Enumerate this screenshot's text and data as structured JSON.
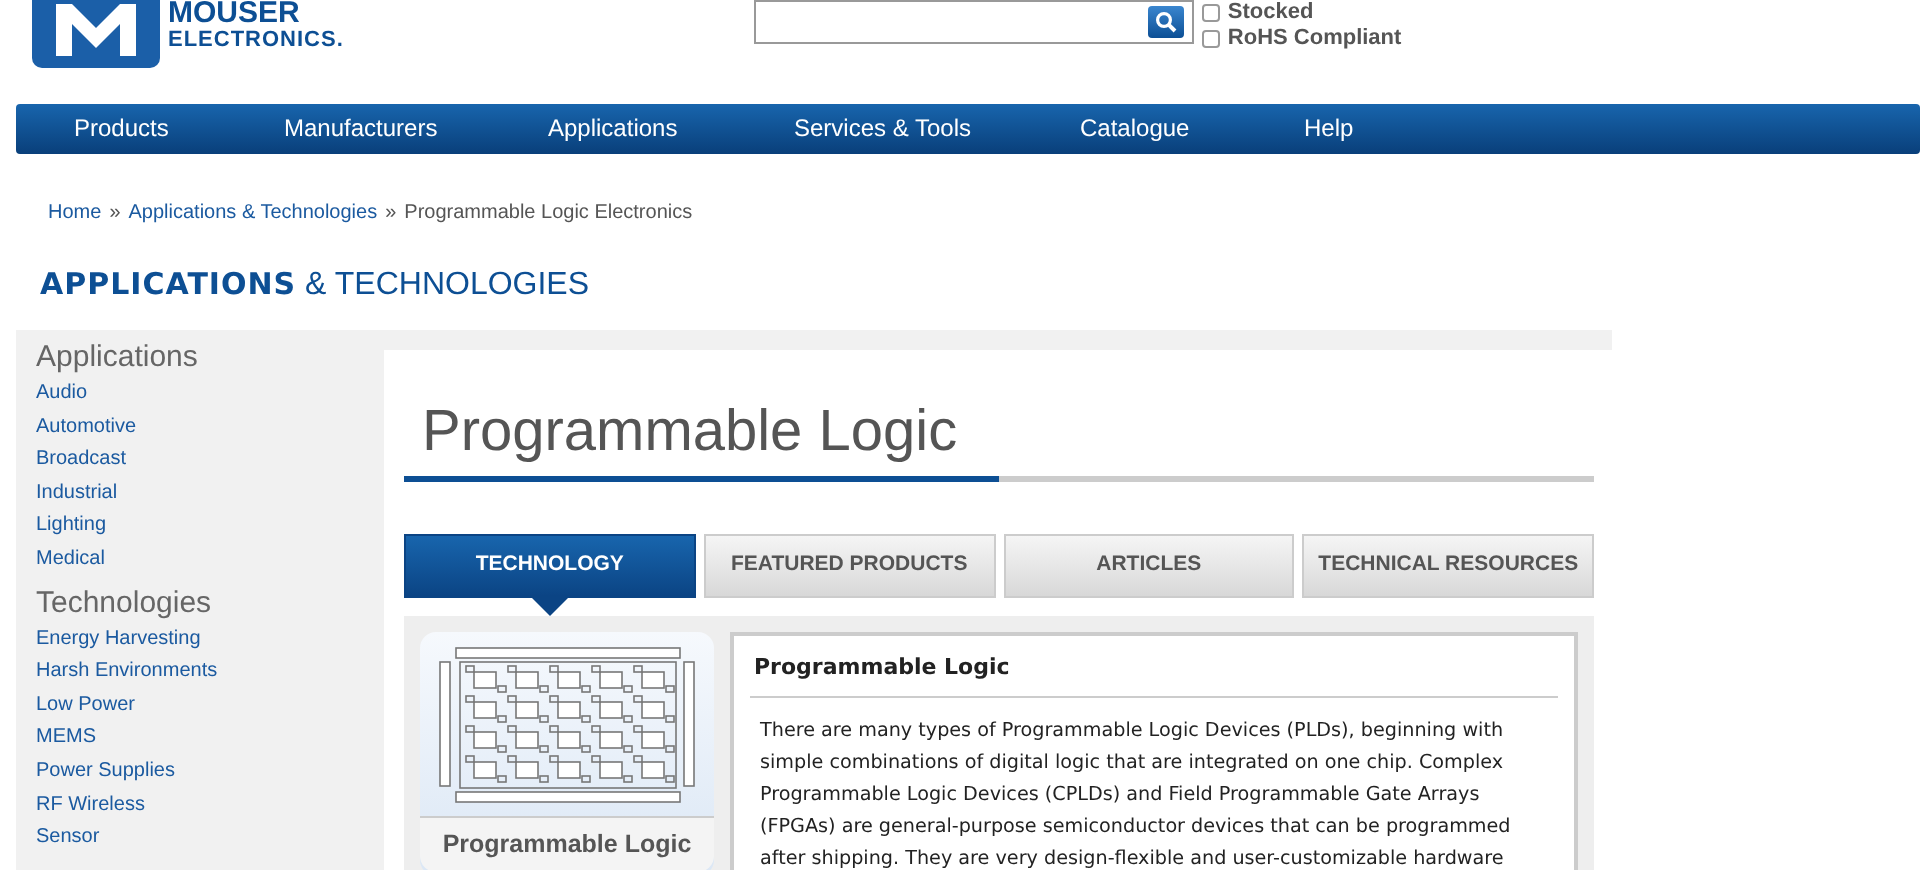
{
  "logo": {
    "name": "MOUSER",
    "subtitle": "ELECTRONICS."
  },
  "filters": [
    {
      "label": "Stocked",
      "checked": false
    },
    {
      "label": "RoHS Compliant",
      "checked": false
    }
  ],
  "nav": [
    "Products",
    "Manufacturers",
    "Applications",
    "Services & Tools",
    "Catalogue",
    "Help"
  ],
  "breadcrumb": [
    {
      "label": "Home",
      "link": true
    },
    {
      "label": "Applications & Technologies",
      "link": true
    },
    {
      "label": "Programmable Logic Electronics",
      "link": false
    }
  ],
  "breadcrumb_separator": "»",
  "section_heading": {
    "bold": "APPLICATIONS",
    "rest": "& TECHNOLOGIES"
  },
  "sidebar": [
    {
      "heading": "Applications",
      "items": [
        "Audio",
        "Automotive",
        "Broadcast",
        "Industrial",
        "Lighting",
        "Medical"
      ]
    },
    {
      "heading": "Technologies",
      "items": [
        "Energy Harvesting",
        "Harsh Environments",
        "Low Power",
        "MEMS",
        "Power Supplies",
        "RF Wireless",
        "Sensor"
      ]
    }
  ],
  "page_title": "Programmable Logic",
  "tabs": [
    {
      "label": "TECHNOLOGY",
      "selected": true
    },
    {
      "label": "FEATURED PRODUCTS",
      "selected": false
    },
    {
      "label": "ARTICLES",
      "selected": false
    },
    {
      "label": "TECHNICAL RESOURCES",
      "selected": false
    }
  ],
  "feature_card": {
    "caption": "Programmable Logic"
  },
  "article": {
    "title": "Programmable Logic",
    "body": "There are many types of Programmable Logic Devices (PLDs), beginning with simple combinations of digital logic that are integrated on one chip. Complex Programmable Logic Devices (CPLDs) and Field Programmable Gate Arrays (FPGAs) are general-purpose semiconductor devices that can be programmed after shipping. They are very design-flexible and user-customizable hardware"
  }
}
